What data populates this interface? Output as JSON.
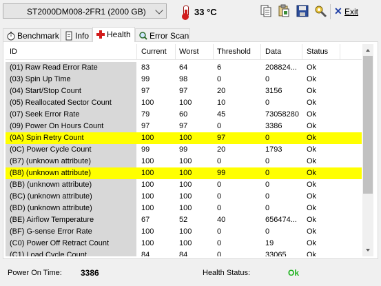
{
  "toolbar": {
    "drive": "ST2000DM008-2FR1 (2000 GB)",
    "temperature": "33 °C",
    "exit_label": "Exit"
  },
  "tabs": [
    {
      "label": "Benchmark"
    },
    {
      "label": "Info"
    },
    {
      "label": "Health"
    },
    {
      "label": "Error Scan"
    }
  ],
  "active_tab": "Health",
  "table": {
    "columns": [
      "ID",
      "Current",
      "Worst",
      "Threshold",
      "Data",
      "Status"
    ],
    "rows": [
      {
        "id": "(01) Raw Read Error Rate",
        "current": "83",
        "worst": "64",
        "threshold": "6",
        "data": "208824...",
        "status": "Ok",
        "highlight": false
      },
      {
        "id": "(03) Spin Up Time",
        "current": "99",
        "worst": "98",
        "threshold": "0",
        "data": "0",
        "status": "Ok",
        "highlight": false
      },
      {
        "id": "(04) Start/Stop Count",
        "current": "97",
        "worst": "97",
        "threshold": "20",
        "data": "3156",
        "status": "Ok",
        "highlight": false
      },
      {
        "id": "(05) Reallocated Sector Count",
        "current": "100",
        "worst": "100",
        "threshold": "10",
        "data": "0",
        "status": "Ok",
        "highlight": false
      },
      {
        "id": "(07) Seek Error Rate",
        "current": "79",
        "worst": "60",
        "threshold": "45",
        "data": "73058280",
        "status": "Ok",
        "highlight": false
      },
      {
        "id": "(09) Power On Hours Count",
        "current": "97",
        "worst": "97",
        "threshold": "0",
        "data": "3386",
        "status": "Ok",
        "highlight": false
      },
      {
        "id": "(0A) Spin Retry Count",
        "current": "100",
        "worst": "100",
        "threshold": "97",
        "data": "0",
        "status": "Ok",
        "highlight": true
      },
      {
        "id": "(0C) Power Cycle Count",
        "current": "99",
        "worst": "99",
        "threshold": "20",
        "data": "1793",
        "status": "Ok",
        "highlight": false
      },
      {
        "id": "(B7) (unknown attribute)",
        "current": "100",
        "worst": "100",
        "threshold": "0",
        "data": "0",
        "status": "Ok",
        "highlight": false
      },
      {
        "id": "(B8) (unknown attribute)",
        "current": "100",
        "worst": "100",
        "threshold": "99",
        "data": "0",
        "status": "Ok",
        "highlight": true
      },
      {
        "id": "(BB) (unknown attribute)",
        "current": "100",
        "worst": "100",
        "threshold": "0",
        "data": "0",
        "status": "Ok",
        "highlight": false
      },
      {
        "id": "(BC) (unknown attribute)",
        "current": "100",
        "worst": "100",
        "threshold": "0",
        "data": "0",
        "status": "Ok",
        "highlight": false
      },
      {
        "id": "(BD) (unknown attribute)",
        "current": "100",
        "worst": "100",
        "threshold": "0",
        "data": "0",
        "status": "Ok",
        "highlight": false
      },
      {
        "id": "(BE) Airflow Temperature",
        "current": "67",
        "worst": "52",
        "threshold": "40",
        "data": "656474...",
        "status": "Ok",
        "highlight": false
      },
      {
        "id": "(BF) G-sense Error Rate",
        "current": "100",
        "worst": "100",
        "threshold": "0",
        "data": "0",
        "status": "Ok",
        "highlight": false
      },
      {
        "id": "(C0) Power Off Retract Count",
        "current": "100",
        "worst": "100",
        "threshold": "0",
        "data": "19",
        "status": "Ok",
        "highlight": false
      },
      {
        "id": "(C1) Load Cycle Count",
        "current": "84",
        "worst": "84",
        "threshold": "0",
        "data": "33065",
        "status": "Ok",
        "highlight": false
      }
    ]
  },
  "statusbar": {
    "power_on_label": "Power On Time:",
    "power_on_value": "3386",
    "health_label": "Health Status:",
    "health_value": "Ok"
  },
  "colors": {
    "highlight": "#ffff00",
    "ok_green": "#1fb31f",
    "id_bg": "#d8d8d8"
  }
}
